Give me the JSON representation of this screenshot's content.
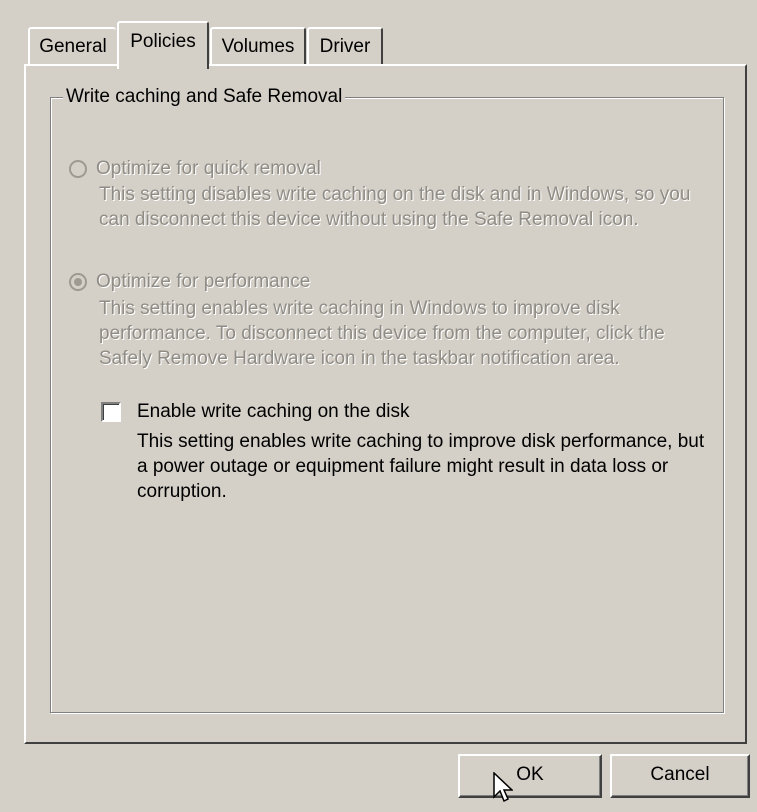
{
  "tabs": [
    {
      "label": "General",
      "active": false
    },
    {
      "label": "Policies",
      "active": true
    },
    {
      "label": "Volumes",
      "active": false
    },
    {
      "label": "Driver",
      "active": false
    }
  ],
  "group": {
    "title": "Write caching and Safe Removal"
  },
  "options": {
    "quick_removal": {
      "label": "Optimize for quick removal",
      "description": "This setting disables write caching on the disk and in Windows, so you can disconnect this device without using the Safe Removal icon.",
      "selected": false,
      "enabled": false
    },
    "performance": {
      "label": "Optimize for performance",
      "description": "This setting enables write caching in Windows to improve disk performance. To disconnect this device from the computer, click the Safely Remove Hardware icon in the taskbar notification area.",
      "selected": true,
      "enabled": false
    }
  },
  "write_cache": {
    "label": "Enable write caching on the disk",
    "description": "This setting enables write caching to improve disk performance, but a power outage or equipment failure might result in data loss or corruption.",
    "checked": false
  },
  "buttons": {
    "ok": "OK",
    "cancel": "Cancel"
  },
  "colors": {
    "dialog_face": "#d4d0c8",
    "disabled_text": "#8f8c85",
    "shadow": "#808080",
    "dark_shadow": "#404040",
    "highlight": "#ffffff"
  },
  "icons": {
    "cursor": "arrow-pointer-icon"
  }
}
